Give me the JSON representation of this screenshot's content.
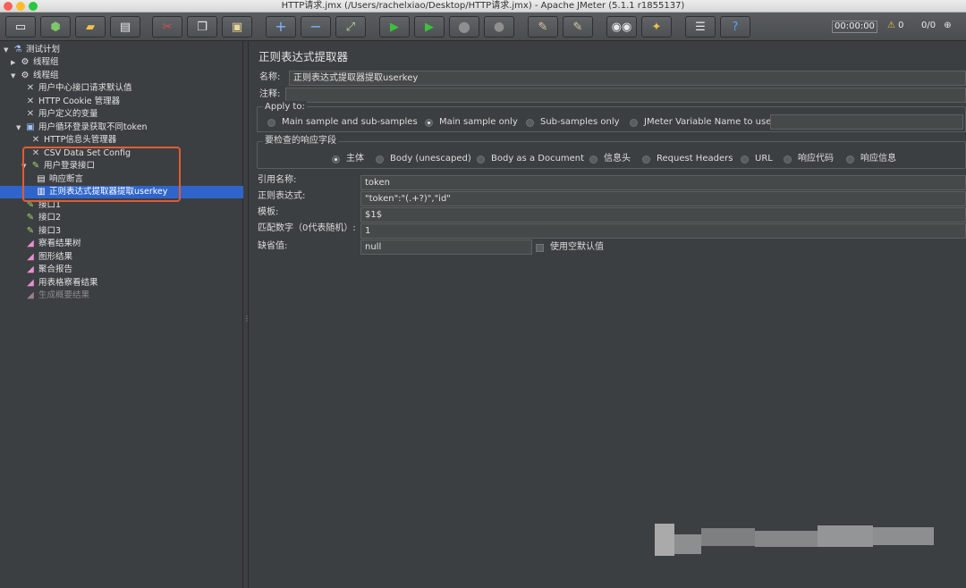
{
  "window": {
    "title": "HTTP请求.jmx (/Users/rachelxiao/Desktop/HTTP请求.jmx) - Apache JMeter (5.1.1 r1855137)"
  },
  "toolbar": {
    "timer": "00:00:00",
    "warning_count": "0",
    "thread_count": "0/0"
  },
  "tree": {
    "items": [
      {
        "label": "测试计划"
      },
      {
        "label": "线程组"
      },
      {
        "label": "线程组"
      },
      {
        "label": "用户中心接口请求默认值"
      },
      {
        "label": "HTTP Cookie 管理器"
      },
      {
        "label": "用户定义的变量"
      },
      {
        "label": "用户循环登录获取不同token"
      },
      {
        "label": "HTTP信息头管理器"
      },
      {
        "label": "CSV Data Set Config"
      },
      {
        "label": "用户登录接口"
      },
      {
        "label": "响应断言"
      },
      {
        "label": "正则表达式提取器提取userkey"
      },
      {
        "label": "接口1"
      },
      {
        "label": "接口2"
      },
      {
        "label": "接口3"
      },
      {
        "label": "察看结果树"
      },
      {
        "label": "图形结果"
      },
      {
        "label": "聚合报告"
      },
      {
        "label": "用表格察看结果"
      },
      {
        "label": "生成概要结果"
      }
    ]
  },
  "panel": {
    "title": "正则表达式提取器",
    "name_label": "名称:",
    "name_value": "正则表达式提取器提取userkey",
    "comment_label": "注释:",
    "comment_value": "",
    "apply_to": {
      "legend": "Apply to:",
      "options": [
        "Main sample and sub-samples",
        "Main sample only",
        "Sub-samples only",
        "JMeter Variable Name to use"
      ],
      "selected": "Main sample only"
    },
    "field_to_check": {
      "legend": "要检查的响应字段",
      "options": [
        "主体",
        "Body (unescaped)",
        "Body as a Document",
        "信息头",
        "Request Headers",
        "URL",
        "响应代码",
        "响应信息"
      ],
      "selected": "主体"
    },
    "ref_name_label": "引用名称:",
    "ref_name_value": "token",
    "regex_label": "正则表达式:",
    "regex_value": "\"token\":\"(.+?)\",\"id\"",
    "template_label": "模板:",
    "template_value": "$1$",
    "match_no_label": "匹配数字（0代表随机）:",
    "match_no_value": "1",
    "default_label": "缺省值:",
    "default_value": "null",
    "use_empty_default_label": "使用空默认值"
  }
}
